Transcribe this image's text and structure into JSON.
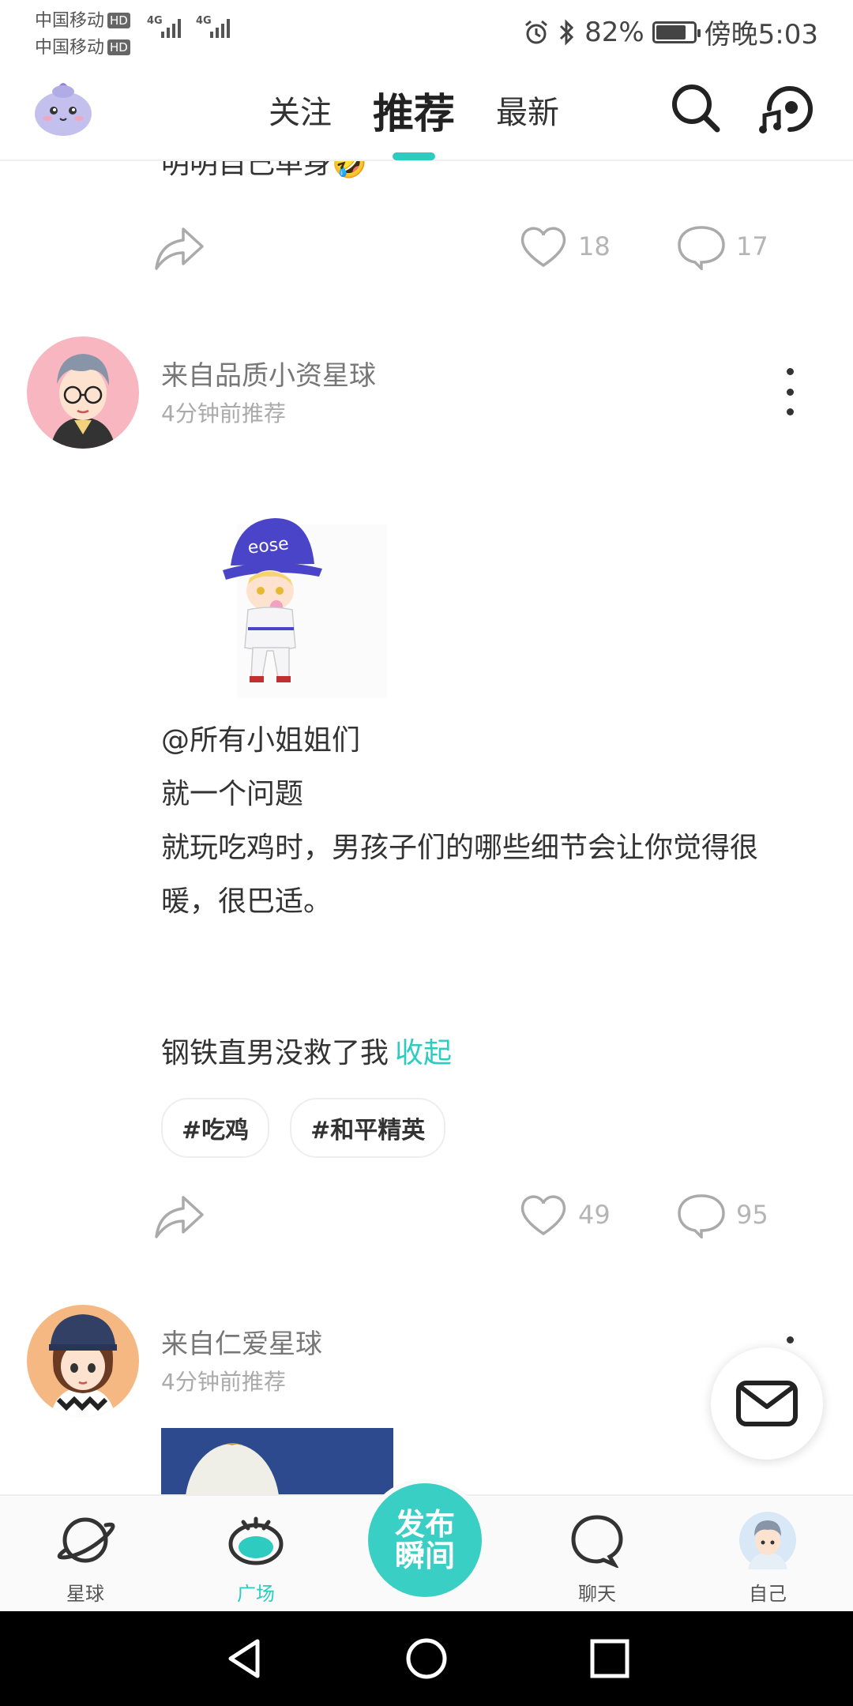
{
  "status_bar": {
    "carrier1": "中国移动",
    "carrier2": "中国移动",
    "hd": "HD",
    "network1": "4G",
    "network2": "4G",
    "battery_percent": "82%",
    "battery_level": 0.82,
    "time": "傍晚5:03"
  },
  "header": {
    "tabs": [
      {
        "label": "关注",
        "active": false
      },
      {
        "label": "推荐",
        "active": true
      },
      {
        "label": "最新",
        "active": false
      }
    ],
    "icons": [
      "mascot-avatar-icon",
      "search-icon",
      "music-voice-icon"
    ],
    "accent_color": "#2ecbc0"
  },
  "feed": {
    "prev_post": {
      "cut_text": "明明自己单身🤣",
      "likes": "18",
      "comments": "17"
    },
    "post": {
      "planet": "来自品质小资星球",
      "time_ago": "4分钟前推荐",
      "lines": [
        "@所有小姐姐们",
        "就一个问题",
        "就玩吃鸡时，男孩子们的哪些细节会让你觉得很",
        "暖，很巴适。"
      ],
      "tail_text": "钢铁直男没救了我",
      "collapse_label": "收起",
      "tags": [
        "#吃鸡",
        "#和平精英"
      ],
      "likes": "49",
      "comments": "95",
      "image_text": "eose"
    },
    "next_post": {
      "planet": "来自仁爱星球",
      "time_ago": "4分钟前推荐"
    }
  },
  "bottom_nav": {
    "items": [
      {
        "label": "星球",
        "active": false
      },
      {
        "label": "广场",
        "active": true
      },
      {
        "label": "聊天",
        "active": false
      },
      {
        "label": "自己",
        "active": false
      }
    ],
    "publish_line1": "发布",
    "publish_line2": "瞬间"
  }
}
